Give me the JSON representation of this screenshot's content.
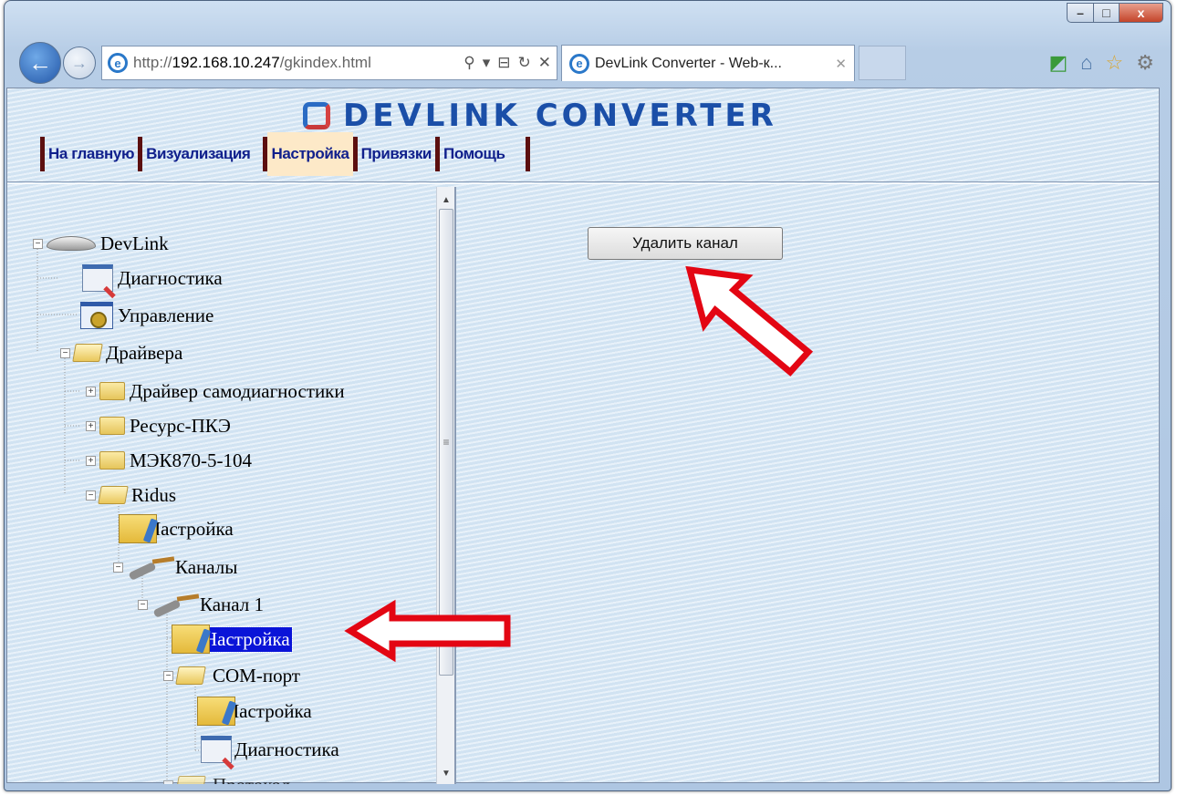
{
  "browser": {
    "url_prefix": "http://",
    "url_host": "192.168.10.247",
    "url_path": "/gkindex.html",
    "tab_title": "DevLink Converter - Web-к...",
    "window_controls": {
      "minimize": "–",
      "maximize": "□",
      "close": "x"
    }
  },
  "app": {
    "logo_text": "DEVLINK CONVERTER",
    "menu": [
      {
        "label": "На главную"
      },
      {
        "label": "Визуализация"
      },
      {
        "label": "Настройка",
        "active": true
      },
      {
        "label": "Привязки"
      },
      {
        "label": "Помощь"
      }
    ]
  },
  "tree": {
    "root": "DevLink",
    "diagnostics": "Диагностика",
    "control": "Управление",
    "drivers": "Драйвера",
    "driver_selfdiag": "Драйвер самодиагностики",
    "driver_resurs": "Ресурс-ПКЭ",
    "driver_iec": "МЭК870-5-104",
    "driver_ridus": "Ridus",
    "ridus_settings": "Настройка",
    "channels": "Каналы",
    "channel1": "Канал 1",
    "channel1_settings": "Настройка",
    "com_port": "COM-порт",
    "com_settings": "Настройка",
    "com_diagnostics": "Диагностика",
    "next_partial": "Протокол"
  },
  "right": {
    "delete_channel_button": "Удалить канал"
  },
  "colors": {
    "selection": "#0a14d8",
    "menu_text": "#10208c",
    "menu_separator": "#5c0f0f",
    "annotation_arrow": "#e30613"
  }
}
